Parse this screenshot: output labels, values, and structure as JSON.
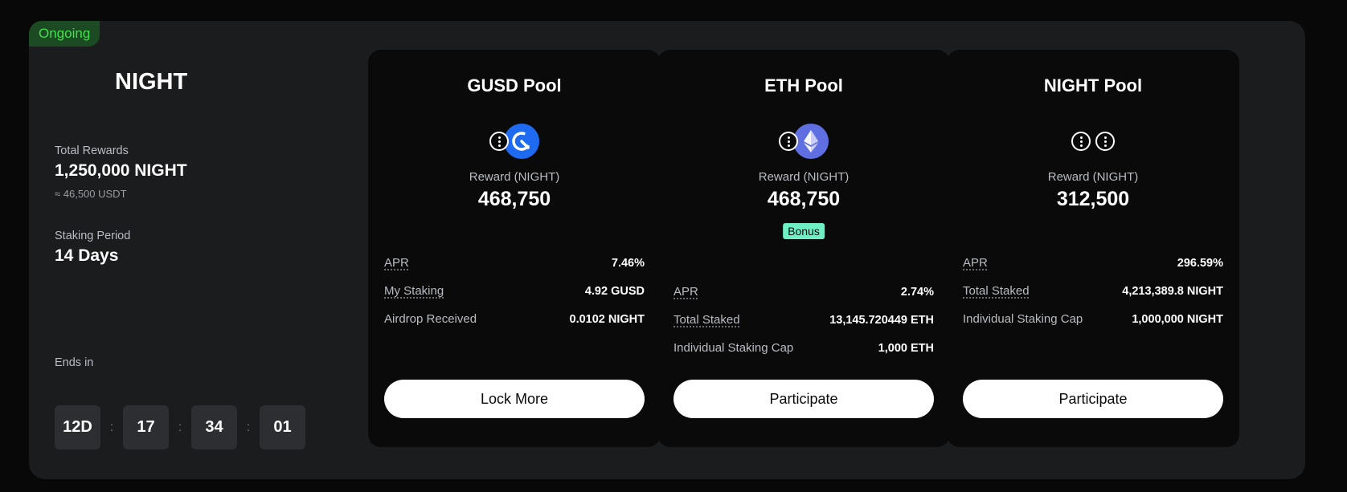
{
  "status": "Ongoing",
  "event": {
    "title": "NIGHT",
    "total_rewards_label": "Total Rewards",
    "total_rewards_value": "1,250,000 NIGHT",
    "total_rewards_usdt": "≈ 46,500 USDT",
    "staking_period_label": "Staking Period",
    "staking_period_value": "14 Days",
    "ends_in_label": "Ends in",
    "countdown": {
      "days": "12D",
      "hours": "17",
      "minutes": "34",
      "seconds": "01",
      "separator": ":"
    }
  },
  "pools": [
    {
      "title": "GUSD Pool",
      "icons": [
        "info-icon",
        "gusd-coin-icon"
      ],
      "reward_label": "Reward (NIGHT)",
      "reward_value": "468,750",
      "rows": [
        {
          "label": "APR",
          "value": "7.46%"
        },
        {
          "label": "My Staking",
          "value": "4.92 GUSD"
        },
        {
          "label": "Airdrop Received",
          "value": "0.0102 NIGHT"
        }
      ],
      "button": "Lock More"
    },
    {
      "title": "ETH Pool",
      "icons": [
        "info-icon",
        "eth-coin-icon"
      ],
      "reward_label": "Reward (NIGHT)",
      "reward_value": "468,750",
      "badge": "Bonus",
      "rows": [
        {
          "label": "APR",
          "value": "2.74%"
        },
        {
          "label": "Total Staked",
          "value": "13,145.720449 ETH"
        },
        {
          "label": "Individual Staking Cap",
          "value": "1,000 ETH"
        }
      ],
      "button": "Participate"
    },
    {
      "title": "NIGHT Pool",
      "icons": [
        "info-icon",
        "info-icon"
      ],
      "reward_label": "Reward (NIGHT)",
      "reward_value": "312,500",
      "rows": [
        {
          "label": "APR",
          "value": "296.59%"
        },
        {
          "label": "Total Staked",
          "value": "4,213,389.8 NIGHT"
        },
        {
          "label": "Individual Staking Cap",
          "value": "1,000,000 NIGHT"
        }
      ],
      "button": "Participate"
    }
  ],
  "colors": {
    "status_bg": "#1c4a22",
    "status_text": "#3fe04b",
    "bonus_bg": "#6ef0c4",
    "gusd_blue": "#1e6af0",
    "eth_purple": "#5f6ee0"
  }
}
